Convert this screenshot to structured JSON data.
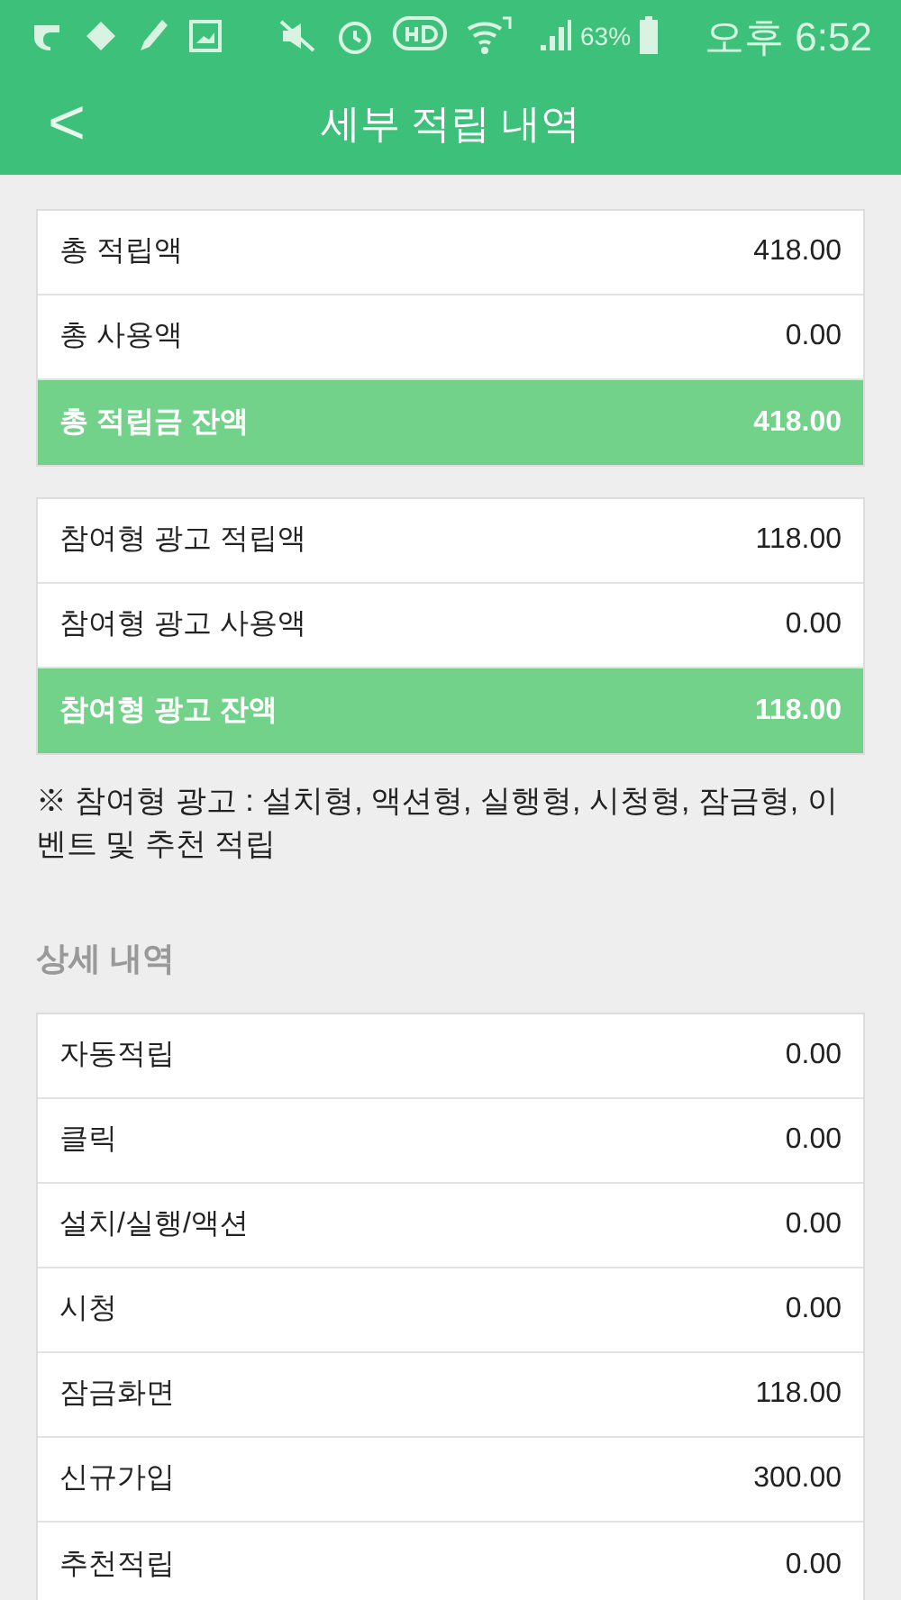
{
  "status_bar": {
    "battery": "63%",
    "time": "오후 6:52"
  },
  "header": {
    "back": "<",
    "title": "세부 적립 내역"
  },
  "summary_cards": [
    {
      "rows": [
        {
          "label": "총 적립액",
          "value": "418.00",
          "kind": "normal"
        },
        {
          "label": "총 사용액",
          "value": "0.00",
          "kind": "normal"
        },
        {
          "label": "총 적립금 잔액",
          "value": "418.00",
          "kind": "total"
        }
      ]
    },
    {
      "rows": [
        {
          "label": "참여형 광고 적립액",
          "value": "118.00",
          "kind": "normal"
        },
        {
          "label": "참여형 광고 사용액",
          "value": "0.00",
          "kind": "normal"
        },
        {
          "label": "참여형 광고 잔액",
          "value": "118.00",
          "kind": "total"
        }
      ]
    }
  ],
  "note": "※ 참여형 광고 : 설치형, 액션형, 실행형, 시청형, 잠금형, 이벤트 및 추천 적립",
  "detail_section": {
    "title": "상세 내역",
    "rows": [
      {
        "label": "자동적립",
        "value": "0.00"
      },
      {
        "label": "클릭",
        "value": "0.00"
      },
      {
        "label": "설치/실행/액션",
        "value": "0.00"
      },
      {
        "label": "시청",
        "value": "0.00"
      },
      {
        "label": "잠금화면",
        "value": "118.00"
      },
      {
        "label": "신규가입",
        "value": "300.00"
      },
      {
        "label": "추천적립",
        "value": "0.00"
      }
    ]
  }
}
